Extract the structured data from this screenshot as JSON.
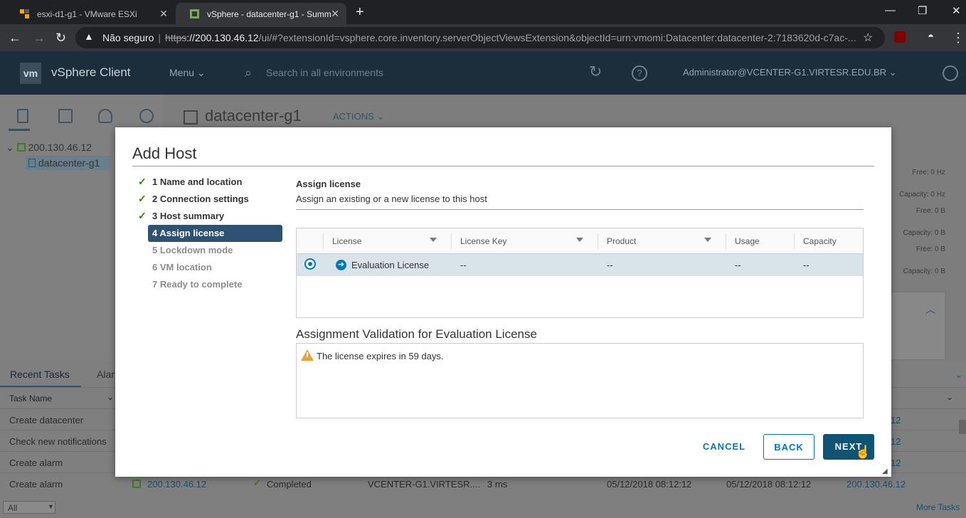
{
  "browser": {
    "tabs": [
      {
        "title": "esxi-d1-g1 - VMware ESXi",
        "close": "✕"
      },
      {
        "title": "vSphere - datacenter-g1 - Summ",
        "close": "✕"
      }
    ],
    "new_tab": "+",
    "insecure_label": "Não seguro",
    "url_scheme": "https",
    "url_host": "://200.130.46.12",
    "url_rest": "/ui/#?extensionId=vsphere.core.inventory.serverObjectViewsExtension&objectId=urn:vmomi:Datacenter:datacenter-2:7183620d-c7ac-..."
  },
  "vsphere": {
    "logo": "vm",
    "title": "vSphere Client",
    "menu": "Menu",
    "search_placeholder": "Search in all environments",
    "user": "Administrator@VCENTER-G1.VIRTESR.EDU.BR"
  },
  "page": {
    "title": "datacenter-g1",
    "actions": "ACTIONS",
    "tree": [
      {
        "label": "200.130.46.12"
      },
      {
        "label": "datacenter-g1"
      }
    ],
    "right_stats": [
      "Free: 0 Hz",
      "Capacity: 0 Hz",
      "Free: 0 B",
      "Capacity: 0 B",
      "Free: 0 B",
      "Capacity: 0 B"
    ]
  },
  "tasks": {
    "tab_recent": "Recent Tasks",
    "tab_alarms": "Alar",
    "col_task_name": "Task Name",
    "rows": [
      {
        "name": "Create datacenter",
        "link": "12"
      },
      {
        "name": "Check new notifications",
        "link": "12"
      },
      {
        "name": "Create alarm",
        "link": "12"
      },
      {
        "name": "Create alarm",
        "target": "200.130.46.12",
        "status": "Completed",
        "initiator": "VCENTER-G1.VIRTESR....",
        "queued": "3 ms",
        "start": "05/12/2018 08:12:12",
        "completion": "05/12/2018 08:12:12",
        "server": "200.130.46.12"
      }
    ],
    "filter": "All",
    "more": "More Tasks"
  },
  "dialog": {
    "title": "Add Host",
    "steps": [
      {
        "label": "1 Name and location",
        "done": true
      },
      {
        "label": "2 Connection settings",
        "done": true
      },
      {
        "label": "3 Host summary",
        "done": true
      },
      {
        "label": "4 Assign license",
        "active": true
      },
      {
        "label": "5 Lockdown mode"
      },
      {
        "label": "6 VM location"
      },
      {
        "label": "7 Ready to complete"
      }
    ],
    "section_title": "Assign license",
    "section_subtitle": "Assign an existing or a new license to this host",
    "grid": {
      "columns": [
        "License",
        "License Key",
        "Product",
        "Usage",
        "Capacity"
      ],
      "row": {
        "license": "Evaluation License",
        "key": "--",
        "product": "--",
        "usage": "--",
        "capacity": "--"
      }
    },
    "validation_title": "Assignment Validation for Evaluation License",
    "validation_message": "The license expires in 59 days.",
    "buttons": {
      "cancel": "CANCEL",
      "back": "BACK",
      "next": "NEXT"
    }
  }
}
